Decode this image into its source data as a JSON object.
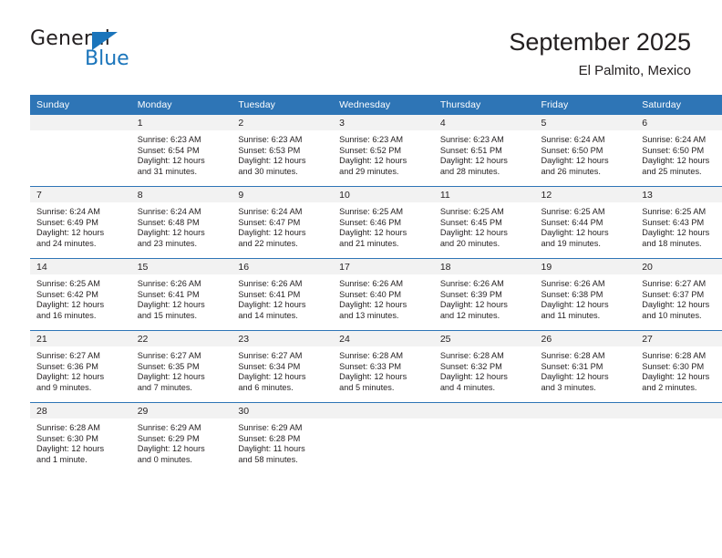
{
  "logo": {
    "word_one": "General",
    "word_two": "Blue",
    "triangle_color": "#1b75bb"
  },
  "header": {
    "title": "September 2025",
    "location": "El Palmito, Mexico"
  },
  "theme": {
    "header_blue": "#2e75b6",
    "daynum_band": "#f2f2f2",
    "text": "#231f20"
  },
  "weekdays": [
    "Sunday",
    "Monday",
    "Tuesday",
    "Wednesday",
    "Thursday",
    "Friday",
    "Saturday"
  ],
  "labels": {
    "sunrise_prefix": "Sunrise:",
    "sunset_prefix": "Sunset:",
    "daylight_prefix": "Daylight:"
  },
  "weeks": [
    [
      {
        "day": "",
        "sunrise": "",
        "sunset": "",
        "daylight_line1": "",
        "daylight_line2": ""
      },
      {
        "day": "1",
        "sunrise": "Sunrise: 6:23 AM",
        "sunset": "Sunset: 6:54 PM",
        "daylight_line1": "Daylight: 12 hours",
        "daylight_line2": "and 31 minutes."
      },
      {
        "day": "2",
        "sunrise": "Sunrise: 6:23 AM",
        "sunset": "Sunset: 6:53 PM",
        "daylight_line1": "Daylight: 12 hours",
        "daylight_line2": "and 30 minutes."
      },
      {
        "day": "3",
        "sunrise": "Sunrise: 6:23 AM",
        "sunset": "Sunset: 6:52 PM",
        "daylight_line1": "Daylight: 12 hours",
        "daylight_line2": "and 29 minutes."
      },
      {
        "day": "4",
        "sunrise": "Sunrise: 6:23 AM",
        "sunset": "Sunset: 6:51 PM",
        "daylight_line1": "Daylight: 12 hours",
        "daylight_line2": "and 28 minutes."
      },
      {
        "day": "5",
        "sunrise": "Sunrise: 6:24 AM",
        "sunset": "Sunset: 6:50 PM",
        "daylight_line1": "Daylight: 12 hours",
        "daylight_line2": "and 26 minutes."
      },
      {
        "day": "6",
        "sunrise": "Sunrise: 6:24 AM",
        "sunset": "Sunset: 6:50 PM",
        "daylight_line1": "Daylight: 12 hours",
        "daylight_line2": "and 25 minutes."
      }
    ],
    [
      {
        "day": "7",
        "sunrise": "Sunrise: 6:24 AM",
        "sunset": "Sunset: 6:49 PM",
        "daylight_line1": "Daylight: 12 hours",
        "daylight_line2": "and 24 minutes."
      },
      {
        "day": "8",
        "sunrise": "Sunrise: 6:24 AM",
        "sunset": "Sunset: 6:48 PM",
        "daylight_line1": "Daylight: 12 hours",
        "daylight_line2": "and 23 minutes."
      },
      {
        "day": "9",
        "sunrise": "Sunrise: 6:24 AM",
        "sunset": "Sunset: 6:47 PM",
        "daylight_line1": "Daylight: 12 hours",
        "daylight_line2": "and 22 minutes."
      },
      {
        "day": "10",
        "sunrise": "Sunrise: 6:25 AM",
        "sunset": "Sunset: 6:46 PM",
        "daylight_line1": "Daylight: 12 hours",
        "daylight_line2": "and 21 minutes."
      },
      {
        "day": "11",
        "sunrise": "Sunrise: 6:25 AM",
        "sunset": "Sunset: 6:45 PM",
        "daylight_line1": "Daylight: 12 hours",
        "daylight_line2": "and 20 minutes."
      },
      {
        "day": "12",
        "sunrise": "Sunrise: 6:25 AM",
        "sunset": "Sunset: 6:44 PM",
        "daylight_line1": "Daylight: 12 hours",
        "daylight_line2": "and 19 minutes."
      },
      {
        "day": "13",
        "sunrise": "Sunrise: 6:25 AM",
        "sunset": "Sunset: 6:43 PM",
        "daylight_line1": "Daylight: 12 hours",
        "daylight_line2": "and 18 minutes."
      }
    ],
    [
      {
        "day": "14",
        "sunrise": "Sunrise: 6:25 AM",
        "sunset": "Sunset: 6:42 PM",
        "daylight_line1": "Daylight: 12 hours",
        "daylight_line2": "and 16 minutes."
      },
      {
        "day": "15",
        "sunrise": "Sunrise: 6:26 AM",
        "sunset": "Sunset: 6:41 PM",
        "daylight_line1": "Daylight: 12 hours",
        "daylight_line2": "and 15 minutes."
      },
      {
        "day": "16",
        "sunrise": "Sunrise: 6:26 AM",
        "sunset": "Sunset: 6:41 PM",
        "daylight_line1": "Daylight: 12 hours",
        "daylight_line2": "and 14 minutes."
      },
      {
        "day": "17",
        "sunrise": "Sunrise: 6:26 AM",
        "sunset": "Sunset: 6:40 PM",
        "daylight_line1": "Daylight: 12 hours",
        "daylight_line2": "and 13 minutes."
      },
      {
        "day": "18",
        "sunrise": "Sunrise: 6:26 AM",
        "sunset": "Sunset: 6:39 PM",
        "daylight_line1": "Daylight: 12 hours",
        "daylight_line2": "and 12 minutes."
      },
      {
        "day": "19",
        "sunrise": "Sunrise: 6:26 AM",
        "sunset": "Sunset: 6:38 PM",
        "daylight_line1": "Daylight: 12 hours",
        "daylight_line2": "and 11 minutes."
      },
      {
        "day": "20",
        "sunrise": "Sunrise: 6:27 AM",
        "sunset": "Sunset: 6:37 PM",
        "daylight_line1": "Daylight: 12 hours",
        "daylight_line2": "and 10 minutes."
      }
    ],
    [
      {
        "day": "21",
        "sunrise": "Sunrise: 6:27 AM",
        "sunset": "Sunset: 6:36 PM",
        "daylight_line1": "Daylight: 12 hours",
        "daylight_line2": "and 9 minutes."
      },
      {
        "day": "22",
        "sunrise": "Sunrise: 6:27 AM",
        "sunset": "Sunset: 6:35 PM",
        "daylight_line1": "Daylight: 12 hours",
        "daylight_line2": "and 7 minutes."
      },
      {
        "day": "23",
        "sunrise": "Sunrise: 6:27 AM",
        "sunset": "Sunset: 6:34 PM",
        "daylight_line1": "Daylight: 12 hours",
        "daylight_line2": "and 6 minutes."
      },
      {
        "day": "24",
        "sunrise": "Sunrise: 6:28 AM",
        "sunset": "Sunset: 6:33 PM",
        "daylight_line1": "Daylight: 12 hours",
        "daylight_line2": "and 5 minutes."
      },
      {
        "day": "25",
        "sunrise": "Sunrise: 6:28 AM",
        "sunset": "Sunset: 6:32 PM",
        "daylight_line1": "Daylight: 12 hours",
        "daylight_line2": "and 4 minutes."
      },
      {
        "day": "26",
        "sunrise": "Sunrise: 6:28 AM",
        "sunset": "Sunset: 6:31 PM",
        "daylight_line1": "Daylight: 12 hours",
        "daylight_line2": "and 3 minutes."
      },
      {
        "day": "27",
        "sunrise": "Sunrise: 6:28 AM",
        "sunset": "Sunset: 6:30 PM",
        "daylight_line1": "Daylight: 12 hours",
        "daylight_line2": "and 2 minutes."
      }
    ],
    [
      {
        "day": "28",
        "sunrise": "Sunrise: 6:28 AM",
        "sunset": "Sunset: 6:30 PM",
        "daylight_line1": "Daylight: 12 hours",
        "daylight_line2": "and 1 minute."
      },
      {
        "day": "29",
        "sunrise": "Sunrise: 6:29 AM",
        "sunset": "Sunset: 6:29 PM",
        "daylight_line1": "Daylight: 12 hours",
        "daylight_line2": "and 0 minutes."
      },
      {
        "day": "30",
        "sunrise": "Sunrise: 6:29 AM",
        "sunset": "Sunset: 6:28 PM",
        "daylight_line1": "Daylight: 11 hours",
        "daylight_line2": "and 58 minutes."
      },
      {
        "day": "",
        "sunrise": "",
        "sunset": "",
        "daylight_line1": "",
        "daylight_line2": ""
      },
      {
        "day": "",
        "sunrise": "",
        "sunset": "",
        "daylight_line1": "",
        "daylight_line2": ""
      },
      {
        "day": "",
        "sunrise": "",
        "sunset": "",
        "daylight_line1": "",
        "daylight_line2": ""
      },
      {
        "day": "",
        "sunrise": "",
        "sunset": "",
        "daylight_line1": "",
        "daylight_line2": ""
      }
    ]
  ]
}
